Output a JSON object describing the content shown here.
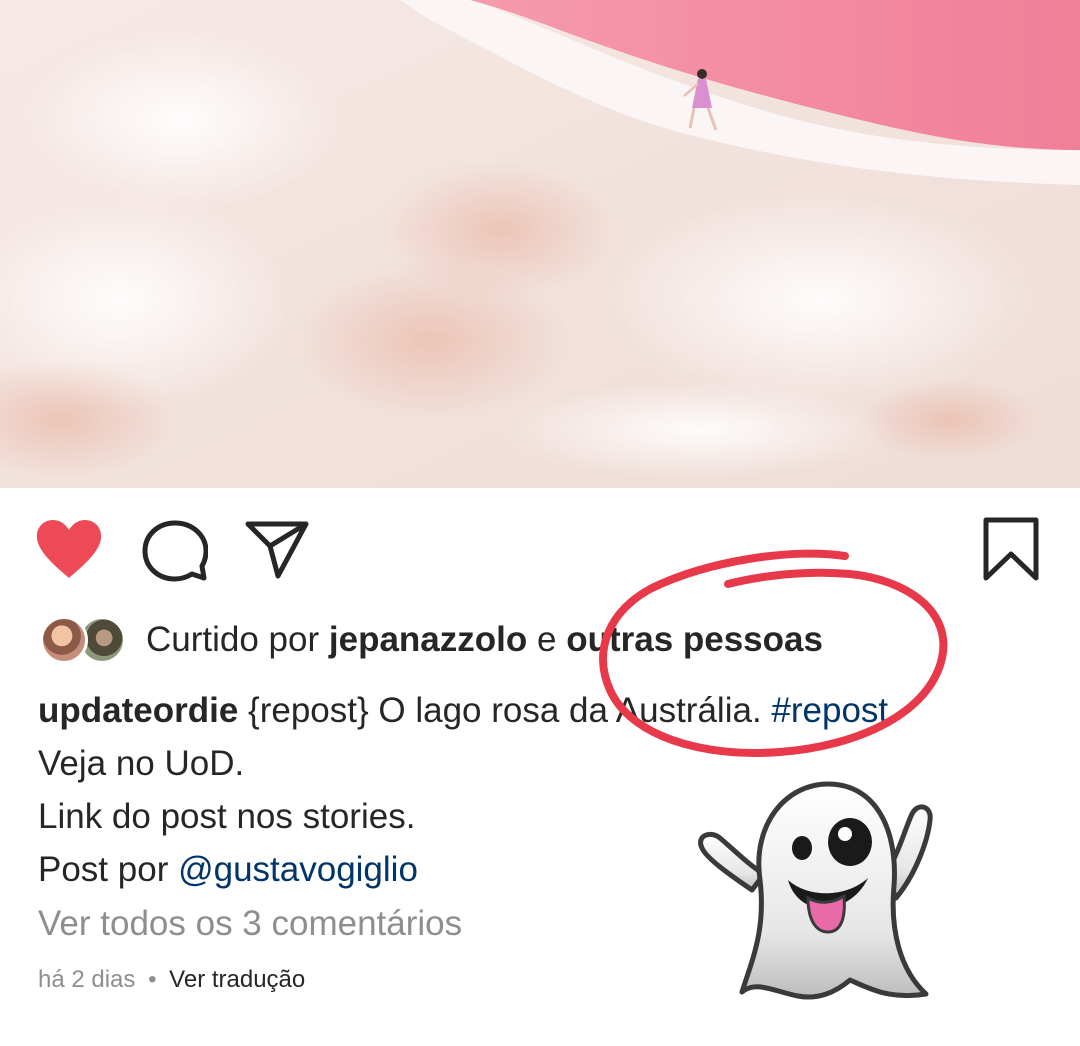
{
  "post": {
    "image_description_icon": "photo",
    "actions": {
      "like_icon": "heart-filled-icon",
      "comment_icon": "comment-bubble-icon",
      "share_icon": "paper-plane-icon",
      "save_icon": "bookmark-icon",
      "like_color": "#ed4956"
    },
    "likes": {
      "prefix": "Curtido por",
      "user": "jepanazzolo",
      "connector": "e",
      "others": "outras pessoas"
    },
    "caption": {
      "username": "updateordie",
      "text": " {repost} O lago rosa da Austrália. ",
      "hashtag": "#repost",
      "line2": "Veja no UoD.",
      "line3": "Link do post nos stories.",
      "line4_prefix": "Post por ",
      "mention": "@gustavogiglio"
    },
    "view_comments": "Ver todos os 3 comentários",
    "timestamp": "há 2 dias",
    "separator": "•",
    "translate": "Ver tradução"
  },
  "overlays": {
    "circle_color": "#e8394a",
    "sticker": "ghost-emoji-icon"
  },
  "colors": {
    "link": "#003569",
    "muted": "#8e8e8e",
    "text": "#262626"
  }
}
